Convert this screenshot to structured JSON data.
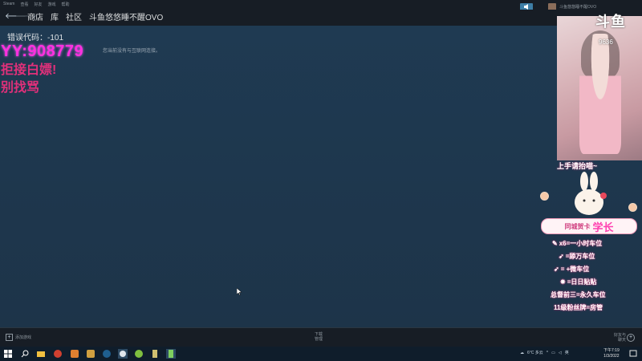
{
  "top_menu": {
    "items": [
      "Steam",
      "查看",
      "好友",
      "游戏",
      "帮助"
    ]
  },
  "nav": {
    "back_icon": "arrow-left-icon",
    "forward_icon": "arrow-right-icon",
    "links": [
      "商店",
      "库",
      "社区",
      "斗鱼悠悠睡不醒OVO"
    ]
  },
  "account": {
    "name": "斗鱼悠悠睡不醒OVO"
  },
  "content": {
    "error_code": "错误代码：-101",
    "error_message": "您当前没有与互联网连接。"
  },
  "stream_overlay_left": {
    "yy": "YY:908779",
    "line2": "拒接白嫖!",
    "line3": "别找骂"
  },
  "webcam": {
    "logo": "斗鱼",
    "room_id": "9636"
  },
  "stream_overlay_right": {
    "header": "上手请抬喵~",
    "title_a": "同城贺卡",
    "title_b": "学长",
    "rows": [
      {
        "icon": "pencil-icon",
        "text": "x6=一小时车位"
      },
      {
        "icon": "rocket-icon",
        "text": "=舔万车位"
      },
      {
        "icon": "rocket-icon",
        "text": "=  +微车位"
      },
      {
        "icon": "firework-icon",
        "text": "=日日贴贴"
      },
      {
        "icon": "flower-icon",
        "text": "总督前三=永久车位"
      },
      {
        "icon": "none",
        "text": "11级粉丝牌=房管"
      }
    ]
  },
  "bottom_bar": {
    "add_game": "添加游戏",
    "downloads_title": "下载",
    "downloads_status": "管理",
    "friends_title": "好友与",
    "friends_sub": "聊天"
  },
  "taskbar": {
    "weather": "6°C 多云",
    "lang": "英",
    "time": "下午7:19",
    "date": "1/3/2022"
  },
  "colors": {
    "steam_bg": "#1b2838",
    "steam_content": "#1f3a52",
    "overlay_pink": "#ff30e0",
    "overlay_red": "#e0307a"
  }
}
